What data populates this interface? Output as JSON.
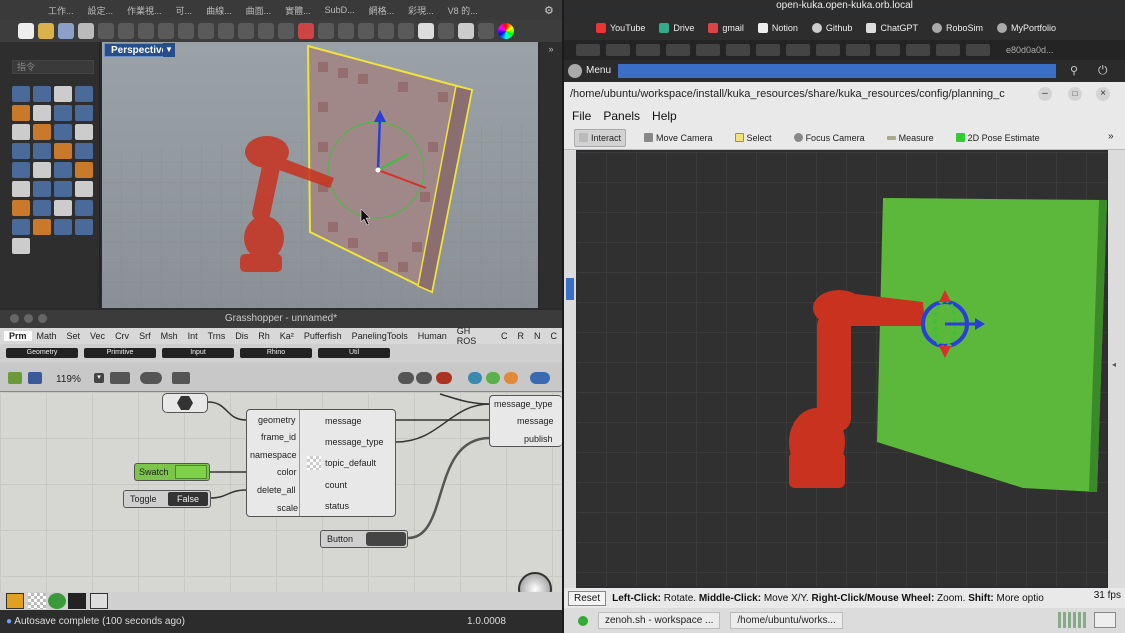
{
  "rhino": {
    "menu": [
      "工作...",
      "設定...",
      "作業視...",
      "可...",
      "曲線...",
      "曲面...",
      "實體...",
      "SubD...",
      "網格...",
      "彩現...",
      "V8 的..."
    ],
    "command_placeholder": "指令",
    "viewport_label": "Perspective"
  },
  "grasshopper": {
    "title": "Grasshopper - unnamed*",
    "tabs": [
      "Prm",
      "Math",
      "Set",
      "Vec",
      "Crv",
      "Srf",
      "Msh",
      "Int",
      "Trns",
      "Dis",
      "Rh",
      "Ka²",
      "Pufferfish",
      "PanelingTools",
      "Human",
      "GH ROS",
      "C",
      "R",
      "N",
      "C"
    ],
    "active_tab": "Prm",
    "subtabs": [
      "Geometry",
      "Primitive",
      "Input",
      "Rhino",
      "Util"
    ],
    "zoom": "119%",
    "main_component": {
      "inputs": [
        "geometry",
        "frame_id",
        "namespace",
        "color",
        "delete_all",
        "scale"
      ],
      "outputs": [
        "message",
        "message_type",
        "topic_default",
        "count",
        "status"
      ]
    },
    "publisher": {
      "inputs": [
        "message_type",
        "message",
        "publish"
      ]
    },
    "swatch_label": "Swatch",
    "toggle_label": "Toggle",
    "toggle_value": "False",
    "button_label": "Button",
    "status": "Autosave complete (100 seconds ago)",
    "version": "1.0.0008"
  },
  "browser": {
    "address": "open-kuka.open-kuka.orb.local",
    "bookmarks": [
      "YouTube",
      "Drive",
      "gmail",
      "Notion",
      "Github",
      "ChatGPT",
      "RoboSim",
      "MyPortfolio"
    ],
    "tab_id": "e80d0a0d..."
  },
  "rviz": {
    "menu_label": "Menu",
    "path": "/home/ubuntu/workspace/install/kuka_resources/share/kuka_resources/config/planning_c",
    "file_menu": [
      "File",
      "Panels",
      "Help"
    ],
    "tools": [
      "Interact",
      "Move Camera",
      "Select",
      "Focus Camera",
      "Measure",
      "2D Pose Estimate"
    ],
    "active_tool": "Interact",
    "reset": "Reset",
    "help_parts": [
      {
        "b": "Left-Click:",
        "t": " Rotate. "
      },
      {
        "b": "Middle-Click:",
        "t": " Move X/Y. "
      },
      {
        "b": "Right-Click/Mouse Wheel:",
        "t": " Zoom. "
      },
      {
        "b": "Shift:",
        "t": " More optio"
      }
    ],
    "fps": "31 fps",
    "taskbar": [
      "zenoh.sh - workspace ...",
      "/home/ubuntu/works..."
    ]
  },
  "colors": {
    "robot": "#c8321e",
    "panel_green": "#5cb83a",
    "gh_canvas": "#d6d6d2",
    "rviz_blue": "#3b6fc7"
  }
}
